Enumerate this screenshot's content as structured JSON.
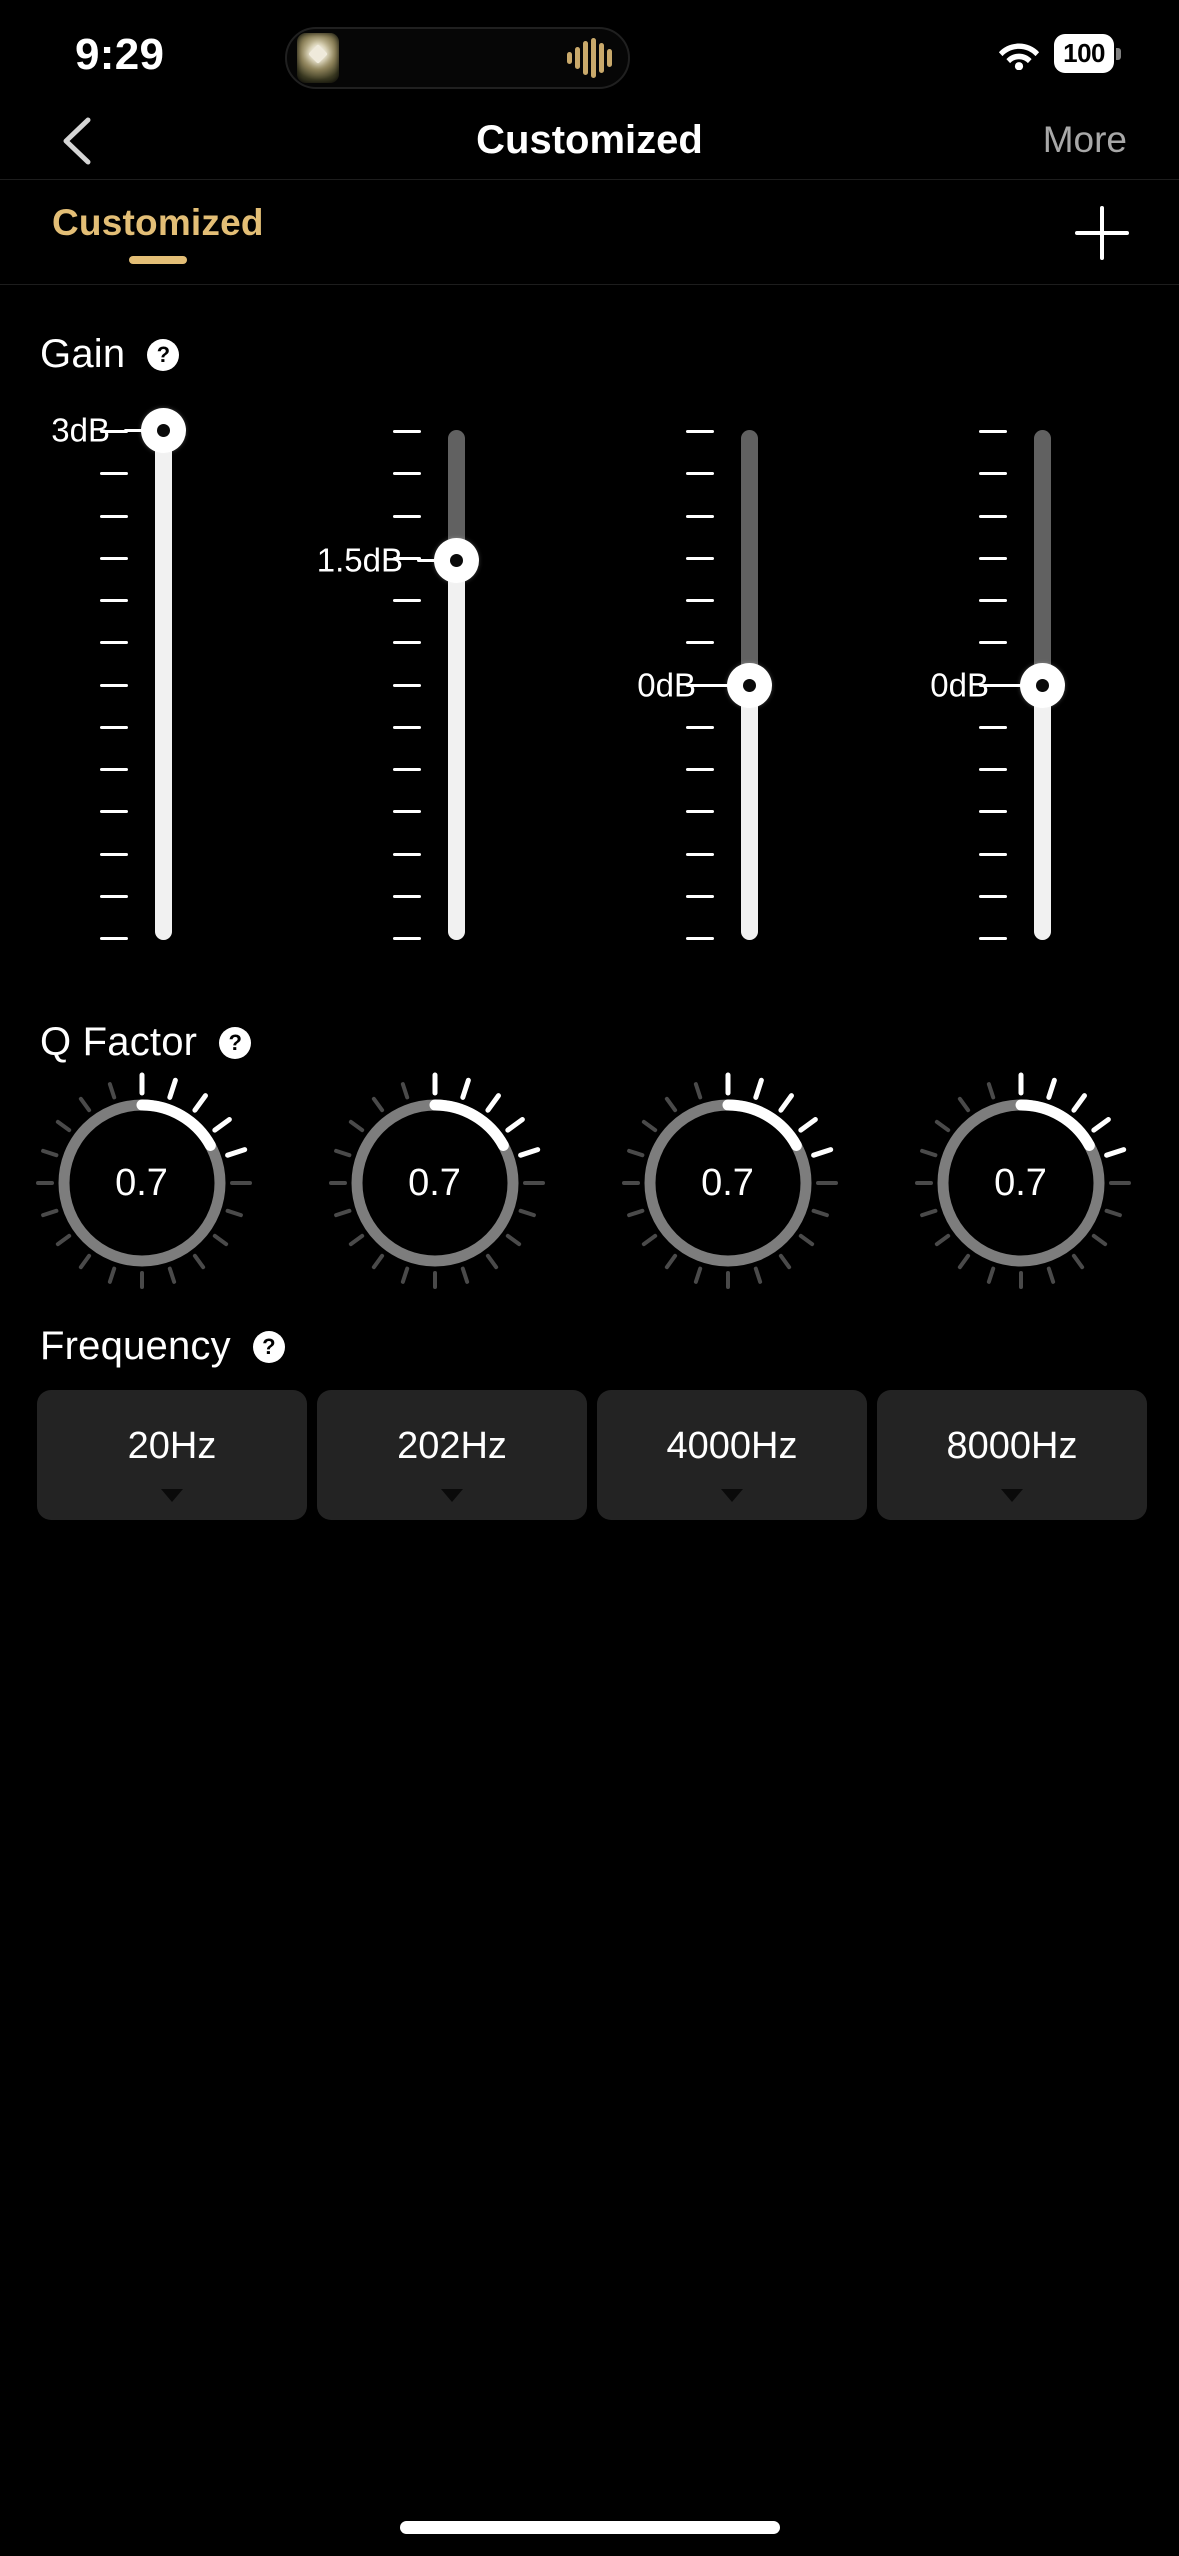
{
  "status_bar": {
    "time": "9:29",
    "wifi_icon": "wifi-icon",
    "battery_level": "100",
    "island_art_icon": "album-art-thumbnail",
    "island_wave_icon": "audio-waveform-icon"
  },
  "nav_bar": {
    "back_icon": "chevron-left-icon",
    "title": "Customized",
    "more_label": "More"
  },
  "tab_bar": {
    "active_tab": "Customized",
    "add_icon": "plus-icon",
    "accent_color": "#e3be76"
  },
  "gain": {
    "title": "Gain",
    "help_icon": "question-mark-icon",
    "help_glyph": "?",
    "sliders": [
      {
        "value_label": "3dB",
        "value": 3.0,
        "fill_ratio": 1.0
      },
      {
        "value_label": "1.5dB",
        "value": 1.5,
        "fill_ratio": 0.745
      },
      {
        "value_label": "0dB",
        "value": 0.0,
        "fill_ratio": 0.5
      },
      {
        "value_label": "0dB",
        "value": 0.0,
        "fill_ratio": 0.5
      }
    ],
    "scale_max": "3dB",
    "scale_min": "-3dB",
    "tick_count": 13
  },
  "q_factor": {
    "title": "Q Factor",
    "help_icon": "question-mark-icon",
    "help_glyph": "?",
    "knobs": [
      {
        "value_label": "0.7",
        "value": 0.7,
        "arc_ratio": 0.17
      },
      {
        "value_label": "0.7",
        "value": 0.7,
        "arc_ratio": 0.17
      },
      {
        "value_label": "0.7",
        "value": 0.7,
        "arc_ratio": 0.17
      },
      {
        "value_label": "0.7",
        "value": 0.7,
        "arc_ratio": 0.17
      }
    ]
  },
  "frequency": {
    "title": "Frequency",
    "help_icon": "question-mark-icon",
    "help_glyph": "?",
    "buttons": [
      {
        "label": "20Hz",
        "caret_icon": "caret-down-icon"
      },
      {
        "label": "202Hz",
        "caret_icon": "caret-down-icon"
      },
      {
        "label": "4000Hz",
        "caret_icon": "caret-down-icon"
      },
      {
        "label": "8000Hz",
        "caret_icon": "caret-down-icon"
      }
    ]
  },
  "home_indicator": "home-indicator-bar"
}
